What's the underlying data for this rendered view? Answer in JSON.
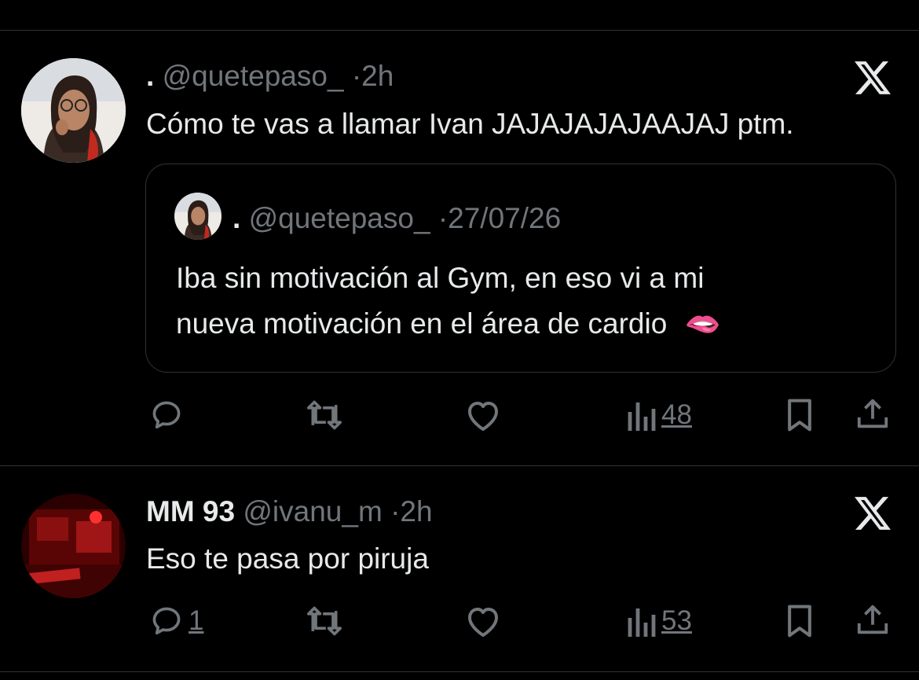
{
  "tweets": [
    {
      "name": ".",
      "handle": "@quetepaso_",
      "separator": "·",
      "time": "2h",
      "text": "Cómo te vas a llamar Ivan JAJAJAJAJAAJAJ ptm.",
      "quote": {
        "name": ".",
        "handle": "@quetepaso_",
        "separator": "·",
        "time": "27/07/26",
        "line1": "Iba sin motivación al Gym, en eso vi a mi",
        "line2": "nueva motivación en el área de cardio",
        "emoji": "🫦"
      },
      "actions": {
        "reply_count": "",
        "views": "48"
      }
    },
    {
      "name": "MM 93",
      "handle": "@ivanu_m",
      "separator": "·",
      "time": "2h",
      "text": "Eso te pasa por piruja",
      "actions": {
        "reply_count": "1",
        "views": "53"
      }
    }
  ],
  "icons": {
    "reply": "reply-icon",
    "retweet": "retweet-icon",
    "like": "like-icon",
    "views": "views-icon",
    "bookmark": "bookmark-icon",
    "share": "share-icon",
    "brand": "x-logo-icon"
  },
  "colors": {
    "background": "#000000",
    "text": "#e7e9ea",
    "muted": "#71767b",
    "border": "#2f3336"
  }
}
